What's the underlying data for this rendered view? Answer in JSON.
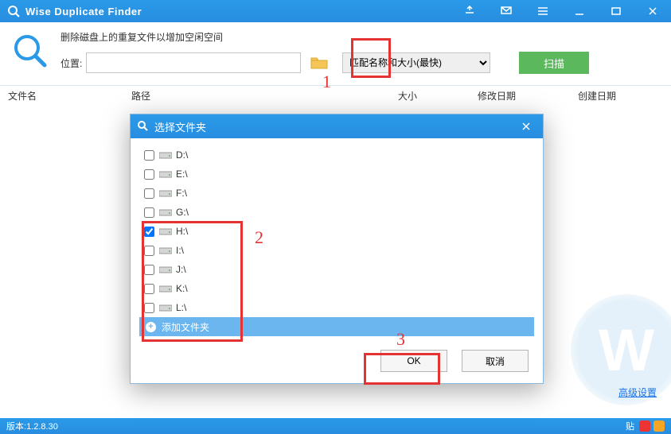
{
  "app": {
    "title": "Wise Duplicate Finder"
  },
  "header": {
    "description": "删除磁盘上的重复文件以增加空闲空间",
    "location_label": "位置:",
    "path_value": "",
    "match_mode": "匹配名称和大小(最快)",
    "scan_label": "扫描"
  },
  "columns": {
    "name": "文件名",
    "path": "路径",
    "size": "大小",
    "modified": "修改日期",
    "created": "创建日期"
  },
  "dialog": {
    "title": "选择文件夹",
    "drives": [
      {
        "label": "D:\\",
        "checked": false
      },
      {
        "label": "E:\\",
        "checked": false
      },
      {
        "label": "F:\\",
        "checked": false
      },
      {
        "label": "G:\\",
        "checked": false
      },
      {
        "label": "H:\\",
        "checked": true
      },
      {
        "label": "I:\\",
        "checked": false
      },
      {
        "label": "J:\\",
        "checked": false
      },
      {
        "label": "K:\\",
        "checked": false
      },
      {
        "label": "L:\\",
        "checked": false
      }
    ],
    "add_folder": "添加文件夹",
    "ok": "OK",
    "cancel": "取消"
  },
  "footer": {
    "advanced": "高级设置",
    "version_prefix": "版本:",
    "version": "1.2.8.30",
    "tray_label": "贴"
  },
  "annotations": {
    "n1": "1",
    "n2": "2",
    "n3": "3"
  }
}
